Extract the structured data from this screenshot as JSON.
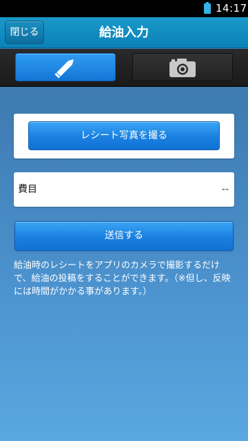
{
  "status_bar": {
    "time": "14:17",
    "battery_icon": "battery-icon"
  },
  "header": {
    "title": "給油入力",
    "close_label": "閉じる"
  },
  "tabs": [
    {
      "icon": "pencil-icon",
      "selected": true
    },
    {
      "icon": "camera-icon",
      "selected": false
    }
  ],
  "receipt": {
    "button_label": "レシート写真を撮る"
  },
  "expense": {
    "label": "費目",
    "value": "--"
  },
  "send": {
    "button_label": "送信する"
  },
  "note": "給油時のレシートをアプリのカメラで撮影するだけで、給油の投稿をすることができます。（※但し、反映には時間がかかる事があります。）",
  "colors": {
    "accent_blue": "#1a80e0",
    "header_blue": "#0a82b8",
    "background": "#3f7cb2"
  }
}
